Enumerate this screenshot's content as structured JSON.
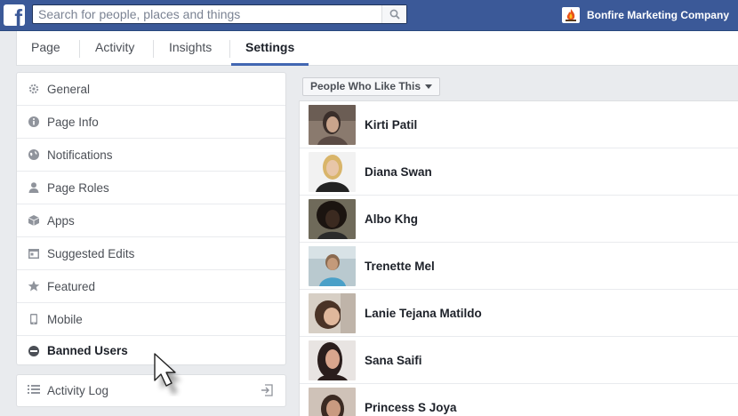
{
  "topbar": {
    "logo_letter": "f",
    "search_placeholder": "Search for people, places and things",
    "page_name": "Bonfire Marketing Company"
  },
  "tabs": [
    {
      "label": "Page"
    },
    {
      "label": "Activity"
    },
    {
      "label": "Insights"
    },
    {
      "label": "Settings",
      "active": true
    }
  ],
  "menu": {
    "items": [
      {
        "label": "General",
        "icon": "gear-icon"
      },
      {
        "label": "Page Info",
        "icon": "info-icon"
      },
      {
        "label": "Notifications",
        "icon": "globe-icon"
      },
      {
        "label": "Page Roles",
        "icon": "person-icon"
      },
      {
        "label": "Apps",
        "icon": "cube-icon"
      },
      {
        "label": "Suggested Edits",
        "icon": "calendar-icon"
      },
      {
        "label": "Featured",
        "icon": "star-icon"
      },
      {
        "label": "Mobile",
        "icon": "phone-icon"
      },
      {
        "label": "Banned Users",
        "icon": "banned-icon",
        "active": true
      }
    ],
    "activity_log": "Activity Log"
  },
  "filter": {
    "label": "People Who Like This"
  },
  "people": [
    {
      "name": "Kirti Patil",
      "avatar_colors": [
        "#8a7a6e",
        "#3a2e2a",
        "#c9a48c"
      ]
    },
    {
      "name": "Diana Swan",
      "avatar_colors": [
        "#f2f2f2",
        "#d9b56a",
        "#222222"
      ]
    },
    {
      "name": "Albo Khg",
      "avatar_colors": [
        "#6f6a5a",
        "#1b1410",
        "#3b2a20"
      ]
    },
    {
      "name": "Trenette Mel",
      "avatar_colors": [
        "#b9c9cf",
        "#c49a7a",
        "#4aa0c8"
      ]
    },
    {
      "name": "Lanie Tejana Matildo",
      "avatar_colors": [
        "#d7cfc5",
        "#4a3326",
        "#e0b89c"
      ]
    },
    {
      "name": "Sana Saifi",
      "avatar_colors": [
        "#e8e4e2",
        "#2a1d1c",
        "#d9a58d"
      ]
    },
    {
      "name": "Princess S Joya",
      "avatar_colors": [
        "#cfc2b8",
        "#3b2a22",
        "#c99a80"
      ]
    }
  ],
  "colors": {
    "topbar": "#3b5998",
    "accent": "#4267b2",
    "page_bg": "#e9ebee"
  }
}
